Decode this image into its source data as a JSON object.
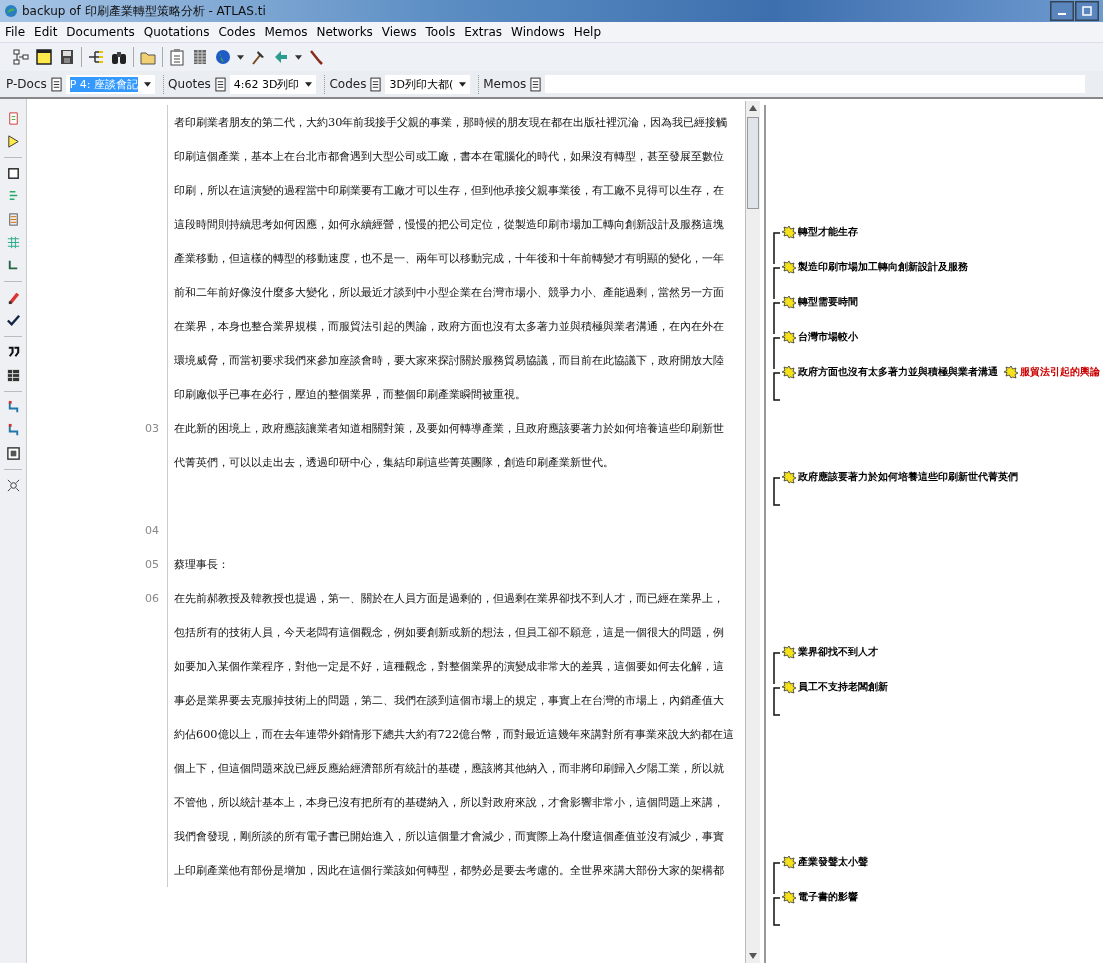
{
  "window": {
    "title": "backup of 印刷產業轉型策略分析 - ATLAS.ti"
  },
  "menu": [
    "File",
    "Edit",
    "Documents",
    "Quotations",
    "Codes",
    "Memos",
    "Networks",
    "Views",
    "Tools",
    "Extras",
    "Windows",
    "Help"
  ],
  "selectors": [
    {
      "label": "P-Docs",
      "value": "P 4: 座談會記",
      "selected": true
    },
    {
      "label": "Quotes",
      "value": "4:62 3D列印",
      "selected": false
    },
    {
      "label": "Codes",
      "value": "3D列印大都(",
      "selected": false
    }
  ],
  "memos": {
    "label": "Memos"
  },
  "document": {
    "rows": [
      {
        "text": "者印刷業者朋友的第二代，大約30年前我接手父親的事業，那時候的朋友現在都在出版社裡沉淪，因為我已經接觸"
      },
      {
        "text": "印刷這個產業，基本上在台北市都會遇到大型公司或工廠，書本在電腦化的時代，如果沒有轉型，甚至發展至數位"
      },
      {
        "text": "印刷，所以在這演變的過程當中印刷業要有工廠才可以生存，但到他承接父親事業後，有工廠不見得可以生存，在",
        "codes": [
          {
            "label": "轉型才能生存",
            "color": "#000000"
          }
        ]
      },
      {
        "text": "這段時間則持續思考如何因應，如何永續經營，慢慢的把公司定位，從製造印刷市場加工轉向創新設計及服務這塊",
        "codes": [
          {
            "label": "製造印刷市場加工轉向創新設計及服務",
            "color": "#000000"
          }
        ]
      },
      {
        "text": "產業移動，但這樣的轉型的移動速度，也不是一、兩年可以移動完成，十年後和十年前轉變才有明顯的變化，一年",
        "codes": [
          {
            "label": "轉型需要時間",
            "color": "#000000"
          }
        ]
      },
      {
        "text": "前和二年前好像沒什麼多大變化，所以最近才談到中小型企業在台灣市場小、競爭力小、產能過剩，當然另一方面",
        "codes": [
          {
            "label": "台灣市場較小",
            "color": "#000000"
          }
        ]
      },
      {
        "text": "在業界，本身也整合業界規模，而服貿法引起的輿論，政府方面也沒有太多著力並與積極與業者溝通，在內在外在",
        "codes": [
          {
            "label": "政府方面也沒有太多著力並與積極與業者溝通",
            "color": "#000000"
          },
          {
            "label": "服貿法引起的輿論",
            "color": "#cc0000"
          }
        ],
        "bracket_end": true
      },
      {
        "text": "環境威脅，而當初要求我們來參加座談會時，要大家來探討關於服務貿易協議，而目前在此協議下，政府開放大陸"
      },
      {
        "text": "印刷廠似乎已事在必行，壓迫的整個業界，而整個印刷產業瞬間被重視。"
      },
      {
        "number": "03",
        "text": "在此新的困境上，政府應該讓業者知道相關對策，及要如何轉導產業，且政府應該要著力於如何培養這些印刷新世",
        "codes": [
          {
            "label": "政府應該要著力於如何培養這些印刷新世代菁英們",
            "color": "#000000"
          }
        ],
        "bracket_end": true
      },
      {
        "text": "代菁英們，可以以走出去，透過印研中心，集結印刷這些菁英團隊，創造印刷產業新世代。"
      },
      {},
      {
        "number": "04"
      },
      {
        "number": "05",
        "text": "蔡理事長："
      },
      {
        "number": "06",
        "text": "在先前郝教授及韓教授也提過，第一、關於在人員方面是過剩的，但過剩在業界卻找不到人才，而已經在業界上，",
        "codes": [
          {
            "label": "業界卻找不到人才",
            "color": "#000000"
          }
        ]
      },
      {
        "text": "包括所有的技術人員，今天老闆有這個觀念，例如要創新或新的想法，但員工卻不願意，這是一個很大的問題，例",
        "codes": [
          {
            "label": "員工不支持老闆創新",
            "color": "#000000"
          }
        ],
        "bracket_end": true
      },
      {
        "text": "如要加入某個作業程序，對他一定是不好，這種觀念，對整個業界的演變成非常大的差異，這個要如何去化解，這"
      },
      {
        "text": "事必是業界要去克服掉技術上的問題，第二、我們在談到這個市場上的規定，事實上在台灣的市場上，內銷產值大"
      },
      {
        "text": "約佔600億以上，而在去年連帶外銷情形下總共大約有722億台幣，而對最近這幾年來講對所有事業來說大約都在這"
      },
      {
        "text": "個上下，但這個問題來說已經反應給經濟部所有統計的基礎，應該將其他納入，而非將印刷歸入夕陽工業，所以就"
      },
      {
        "text": "不管他，所以統計基本上，本身已沒有把所有的基礎納入，所以對政府來說，才會影響非常小，這個問題上來講，",
        "codes": [
          {
            "label": "產業發聲太小聲",
            "color": "#000000"
          }
        ]
      },
      {
        "text": "我們會發現，剛所談的所有電子書已開始進入，所以這個量才會減少，而實際上為什麼這個產值並沒有減少，事實",
        "codes": [
          {
            "label": "電子書的影響",
            "color": "#000000"
          }
        ],
        "bracket_end": true
      },
      {
        "text": "上印刷產業他有部份是增加，因此在這個行業該如何轉型，都勢必是要去考慮的。全世界來講大部份大家的架構都"
      }
    ]
  }
}
